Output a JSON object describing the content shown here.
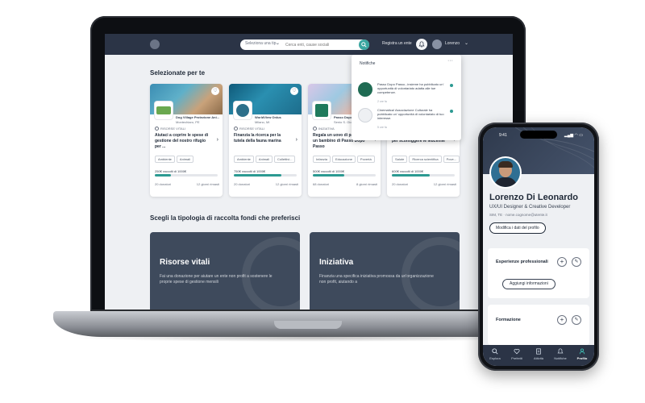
{
  "colors": {
    "navy": "#2b3446",
    "teal": "#2c9a92",
    "card_dark": "#3e4a5c",
    "background": "#eef0f3"
  },
  "nav": {
    "search_category": "Seleziona una tip.",
    "search_placeholder": "Cerca enti, cause sociali",
    "register": "Registra un ente",
    "user_name": "Lorenzo",
    "icons": {
      "search": "search-icon",
      "bell": "bell-icon",
      "chevron": "chevron-down-icon"
    }
  },
  "section_featured": "Selezionate per te",
  "section_types": "Scegli la tipologia di raccolta fondi che preferisci",
  "cards": [
    {
      "org": "Dog Village Protezione Ani...",
      "location": "Montechiaro, PE",
      "type": "RISORSE VITALI",
      "title": "Aiutaci a coprire le spese di gestione del nostro rifugio per ...",
      "tags": [
        "Ambiente",
        "Animali"
      ],
      "raised": "250€ raccolti di 1000€",
      "progress": 0.25,
      "donors": "20 donatori",
      "days_left": "12 giorni rimasti"
    },
    {
      "org": "WorldView Onlus",
      "location": "Milano, MI",
      "type": "RISORSE VITALI",
      "title": "Finanzia la ricerca per la tutela della fauna marina",
      "tags": [
        "Ambiente",
        "Animali",
        "Collettivi..."
      ],
      "raised": "750€ raccolti di 1000€",
      "progress": 0.75,
      "donors": "20 donatori",
      "days_left": "12 giorni rimasti"
    },
    {
      "org": "Passo Dopo Passo",
      "location": "Senio S. Giovanni",
      "type": "INIZIATIVA",
      "title": "Regala un uovo di pasqua a un bambino di Passo Dopo Passo",
      "tags": [
        "Infanzia",
        "Educazione",
        "Povertà"
      ],
      "raised": "500€ raccolti di 1000€",
      "progress": 0.5,
      "donors": "68 donatori",
      "days_left": "8 giorni rimasti"
    },
    {
      "org": "",
      "location": "",
      "type": "",
      "title": "Finanzia la ricerca scientifica per sconfiggere le leucemie",
      "tags": [
        "Salute",
        "Ricerca scientifica",
        "Pove..."
      ],
      "raised": "600€ raccolti di 1000€",
      "progress": 0.6,
      "donors": "20 donatori",
      "days_left": "12 giorni rimasti"
    }
  ],
  "big_cards": [
    {
      "title": "Risorse vitali",
      "text": "Fai una donazione per aiutare un ente non profit a sostenere le proprie spese di gestione mensili"
    },
    {
      "title": "Iniziativa",
      "text": "Finanzia una specifica iniziativa promossa da un'organizzazione non profit, aiutando a"
    }
  ],
  "notifications": {
    "title": "Notifiche",
    "items": [
      {
        "text": "Passo Dopo Passo...insieme ha pubblicato un' opportunità di volontariato adatta alle tue competenze.",
        "time": "2 ore fa"
      },
      {
        "text": "Cinematica! Associazione Culturale ha pubblicato un' opportunità di volontariato di tuo interesse.",
        "time": "5 ore fa"
      }
    ]
  },
  "phone": {
    "time": "9:41",
    "name": "Lorenzo Di Leonardo",
    "role": "UX/UI Designer & Creative Developer",
    "meta": "SIM, TE   ·   nome.cognome@utente.it",
    "edit_button": "Modifica i dati del profilo",
    "sections": [
      {
        "title": "Esperienze professionali",
        "button": "Aggiungi informazioni"
      },
      {
        "title": "Formazione"
      }
    ],
    "tabs": [
      "Esplora",
      "Preferiti",
      "Attività",
      "Notifiche",
      "Profilo"
    ],
    "active_tab": "Profilo"
  }
}
